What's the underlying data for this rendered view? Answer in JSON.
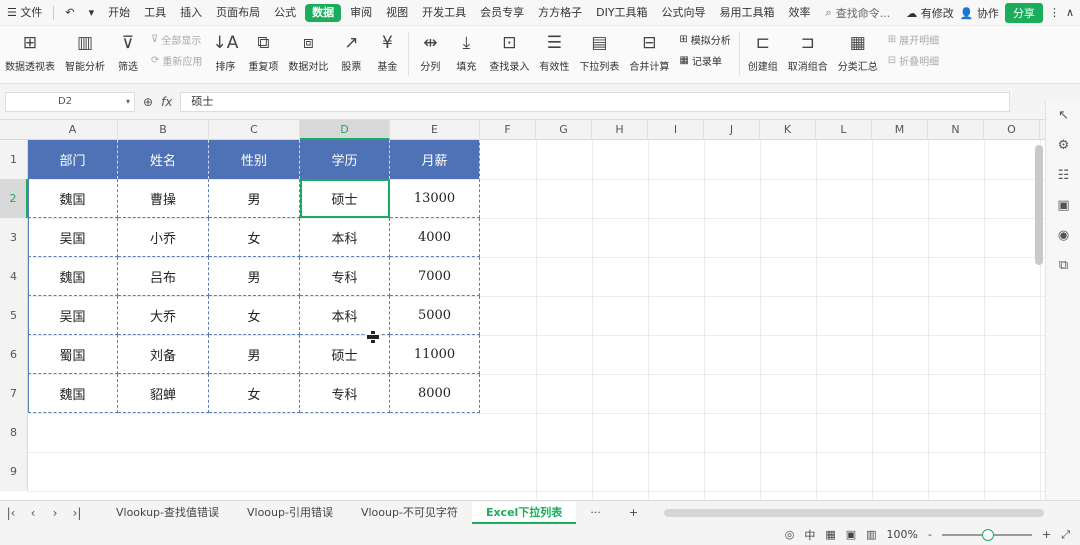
{
  "menubar": {
    "file_label": "文件",
    "items": [
      "开始",
      "工具",
      "插入",
      "页面布局",
      "公式",
      "数据",
      "审阅",
      "视图",
      "开发工具",
      "会员专享",
      "方方格子",
      "DIY工具箱",
      "公式向导",
      "易用工具箱",
      "效率"
    ],
    "active_index": 5,
    "search_placeholder": "查找命令...",
    "has_changes": "有修改",
    "collab": "协作",
    "share": "分享"
  },
  "ribbon": {
    "pivot": "数据透视表",
    "smart_analysis": "智能分析",
    "filter": "筛选",
    "show_all": "全部显示",
    "reapply": "重新应用",
    "sort": "排序",
    "duplicates": "重复项",
    "compare": "数据对比",
    "stocks": "股票",
    "fund": "基金",
    "split_col": "分列",
    "fill": "填充",
    "lookup_entry": "查找录入",
    "validity": "有效性",
    "dropdown": "下拉列表",
    "consolidate": "合并计算",
    "simulation": "模拟分析",
    "record": "记录单",
    "group": "创建组",
    "ungroup": "取消组合",
    "subtotal": "分类汇总",
    "expand": "展开明细",
    "collapse": "折叠明细"
  },
  "formula_bar": {
    "cell_ref": "D2",
    "fx": "fx",
    "value": "硕士"
  },
  "columns": [
    "A",
    "B",
    "C",
    "D",
    "E",
    "F",
    "G",
    "H",
    "I",
    "J",
    "K",
    "L",
    "M",
    "N",
    "O"
  ],
  "rows": [
    "1",
    "2",
    "3",
    "4",
    "5",
    "6",
    "7",
    "8",
    "9"
  ],
  "table": {
    "headers": [
      "部门",
      "姓名",
      "性别",
      "学历",
      "月薪"
    ],
    "data": [
      [
        "魏国",
        "曹操",
        "男",
        "硕士",
        "13000"
      ],
      [
        "吴国",
        "小乔",
        "女",
        "本科",
        "4000"
      ],
      [
        "魏国",
        "吕布",
        "男",
        "专科",
        "7000"
      ],
      [
        "吴国",
        "大乔",
        "女",
        "本科",
        "5000"
      ],
      [
        "蜀国",
        "刘备",
        "男",
        "硕士",
        "11000"
      ],
      [
        "魏国",
        "貂蝉",
        "女",
        "专科",
        "8000"
      ]
    ],
    "header_color": "#4e72b5",
    "selection_color": "#1aad5c"
  },
  "sheet_tabs": {
    "tabs": [
      "Vlookup-查找值错误",
      "Vlooup-引用错误",
      "Vlooup-不可见字符",
      "Excel下拉列表"
    ],
    "active_index": 3,
    "more": "···",
    "add": "+"
  },
  "status": {
    "zoom": "100%",
    "minus": "-",
    "plus": "+"
  }
}
